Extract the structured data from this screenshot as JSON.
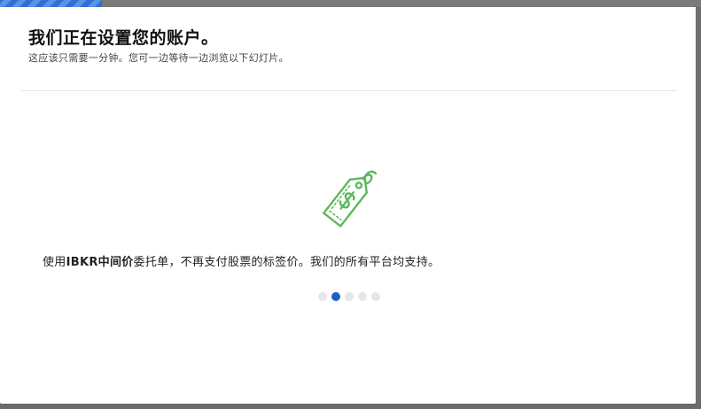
{
  "header": {
    "title": "我们正在设置您的账户。",
    "subtitle": "这应该只需要一分钟。您可一边等待一边浏览以下幻灯片。"
  },
  "progress": {
    "fraction": 0.145,
    "color": "#2f6fd6"
  },
  "slide": {
    "text_before": "使用",
    "text_strong": "IBKR中间价",
    "text_after": "委托单，不再支付股票的标签价。我们的所有平台均支持。",
    "icon": "price-tag-dollar-icon",
    "icon_color": "#5cb85c"
  },
  "carousel": {
    "count": 5,
    "active_index": 1,
    "active_color": "#1f5fc2",
    "inactive_color": "#e4e6ea"
  }
}
